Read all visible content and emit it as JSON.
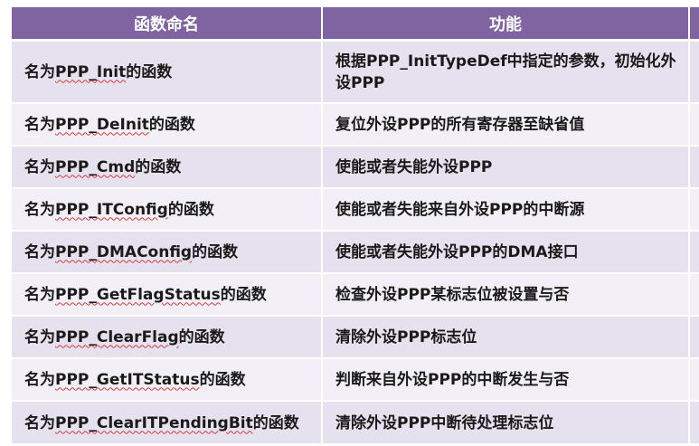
{
  "table": {
    "headers": [
      "函数命名",
      "功能"
    ],
    "rows": [
      {
        "prefix": "名为",
        "name": "PPP_Init",
        "suffix": "的函数",
        "desc": "根据PPP_InitTypeDef中指定的参数，初始化外设PPP"
      },
      {
        "prefix": "名为",
        "name": "PPP_DeInit",
        "suffix": "的函数",
        "desc": "复位外设PPP的所有寄存器至缺省值"
      },
      {
        "prefix": "名为",
        "name": "PPP_Cmd",
        "suffix": "的函数",
        "desc": "使能或者失能外设PPP"
      },
      {
        "prefix": "名为",
        "name": "PPP_ITConfig",
        "suffix": "的函数",
        "desc": "使能或者失能来自外设PPP的中断源"
      },
      {
        "prefix": "名为",
        "name": "PPP_DMAConfig",
        "suffix": "的函数",
        "desc": "使能或者失能外设PPP的DMA接口"
      },
      {
        "prefix": "名为",
        "name": "PPP_GetFlagStatus",
        "suffix": "的函数",
        "desc": "检查外设PPP某标志位被设置与否"
      },
      {
        "prefix": "名为",
        "name": "PPP_ClearFlag",
        "suffix": "的函数",
        "desc": "清除外设PPP标志位"
      },
      {
        "prefix": "名为",
        "name": "PPP_GetITStatus",
        "suffix": "的函数",
        "desc": "判断来自外设PPP的中断发生与否"
      },
      {
        "prefix": "名为",
        "name": "PPP_ClearITPendingBit",
        "suffix": "的函数",
        "desc": "清除外设PPP中断待处理标志位"
      }
    ]
  },
  "colors": {
    "header_bg": "#8064a2",
    "row_odd": "#e6e1ee",
    "row_even": "#f2f0f6",
    "squiggle": "#d23c3c"
  }
}
